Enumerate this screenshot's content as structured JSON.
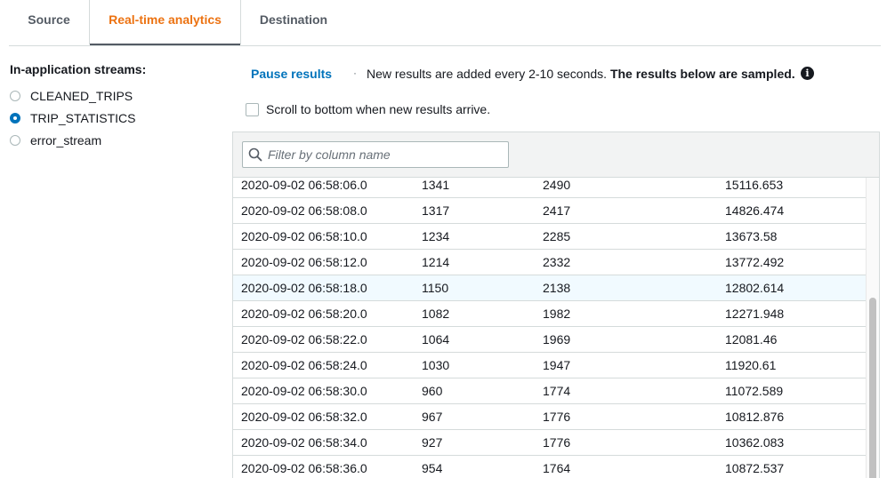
{
  "tabs": [
    {
      "label": "Source"
    },
    {
      "label": "Real-time analytics",
      "active": true
    },
    {
      "label": "Destination"
    }
  ],
  "streams": {
    "title": "In-application streams:",
    "items": [
      {
        "label": "CLEANED_TRIPS",
        "selected": false
      },
      {
        "label": "TRIP_STATISTICS",
        "selected": true
      },
      {
        "label": "error_stream",
        "selected": false
      }
    ]
  },
  "controls": {
    "pause_label": "Pause results",
    "separator": "·",
    "info_text": "New results are added every 2-10 seconds.",
    "info_bold": "The results below are sampled.",
    "info_icon": "info-icon",
    "scroll_label": "Scroll to bottom when new results arrive.",
    "scroll_checked": false
  },
  "filter": {
    "placeholder": "Filter by column name",
    "value": ""
  },
  "rows": [
    [
      "2020-09-02 06:58:06.0",
      "1341",
      "2490",
      "15116.653"
    ],
    [
      "2020-09-02 06:58:08.0",
      "1317",
      "2417",
      "14826.474"
    ],
    [
      "2020-09-02 06:58:10.0",
      "1234",
      "2285",
      "13673.58"
    ],
    [
      "2020-09-02 06:58:12.0",
      "1214",
      "2332",
      "13772.492"
    ],
    [
      "2020-09-02 06:58:18.0",
      "1150",
      "2138",
      "12802.614"
    ],
    [
      "2020-09-02 06:58:20.0",
      "1082",
      "1982",
      "12271.948"
    ],
    [
      "2020-09-02 06:58:22.0",
      "1064",
      "1969",
      "12081.46"
    ],
    [
      "2020-09-02 06:58:24.0",
      "1030",
      "1947",
      "11920.61"
    ],
    [
      "2020-09-02 06:58:30.0",
      "960",
      "1774",
      "11072.589"
    ],
    [
      "2020-09-02 06:58:32.0",
      "967",
      "1776",
      "10812.876"
    ],
    [
      "2020-09-02 06:58:34.0",
      "927",
      "1776",
      "10362.083"
    ],
    [
      "2020-09-02 06:58:36.0",
      "954",
      "1764",
      "10872.537"
    ]
  ],
  "highlighted_row": 4,
  "colors": {
    "accent": "#ec7211",
    "link": "#0073bb",
    "highlight": "#f1faff"
  }
}
